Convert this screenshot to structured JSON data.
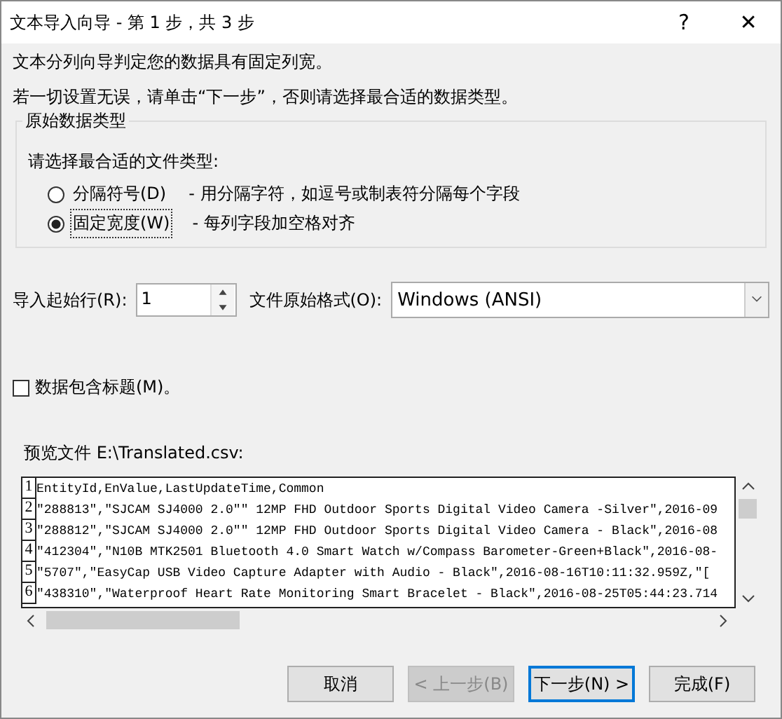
{
  "window": {
    "title": "文本导入向导 - 第 1 步，共 3 步",
    "help": "?",
    "close": "✕"
  },
  "intro": [
    "文本分列向导判定您的数据具有固定列宽。",
    "若一切设置无误，请单击“下一步”，否则请选择最合适的数据类型。"
  ],
  "group": {
    "title": "原始数据类型",
    "prompt": "请选择最合适的文件类型:",
    "options": [
      {
        "label": "分隔符号(D)",
        "description": "- 用分隔字符，如逗号或制表符分隔每个字段",
        "selected": false
      },
      {
        "label": "固定宽度(W)",
        "description": "- 每列字段加空格对齐",
        "selected": true
      }
    ]
  },
  "start_row": {
    "label": "导入起始行(R):",
    "value": "1"
  },
  "file_origin": {
    "label": "文件原始格式(O):",
    "value": "Windows (ANSI)"
  },
  "headers_checkbox": {
    "label": "数据包含标题(M)。",
    "checked": false
  },
  "preview": {
    "label": "预览文件 E:\\Translated.csv:",
    "rows": [
      {
        "number": "1",
        "text": "EntityId,EnValue,LastUpdateTime,Common"
      },
      {
        "number": "2",
        "text": "\"288813\",\"SJCAM SJ4000 2.0\"\" 12MP FHD Outdoor Sports Digital Video Camera -Silver\",2016-09"
      },
      {
        "number": "3",
        "text": "\"288812\",\"SJCAM SJ4000 2.0\"\" 12MP FHD Outdoor Sports Digital Video Camera - Black\",2016-08"
      },
      {
        "number": "4",
        "text": "\"412304\",\"N10B MTK2501 Bluetooth 4.0 Smart Watch w/Compass Barometer-Green+Black\",2016-08-"
      },
      {
        "number": "5",
        "text": "\"5707\",\"EasyCap USB Video Capture Adapter with Audio - Black\",2016-08-16T10:11:32.959Z,\"["
      },
      {
        "number": "6",
        "text": "\"438310\",\"Waterproof Heart Rate Monitoring Smart Bracelet - Black\",2016-08-25T05:44:23.714"
      }
    ]
  },
  "buttons": [
    {
      "label": "取消",
      "disabled": false,
      "default": false
    },
    {
      "label": "< 上一步(B)",
      "disabled": true,
      "default": false
    },
    {
      "label": "下一步(N) >",
      "disabled": false,
      "default": true
    },
    {
      "label": "完成(F)",
      "disabled": false,
      "default": false
    }
  ]
}
